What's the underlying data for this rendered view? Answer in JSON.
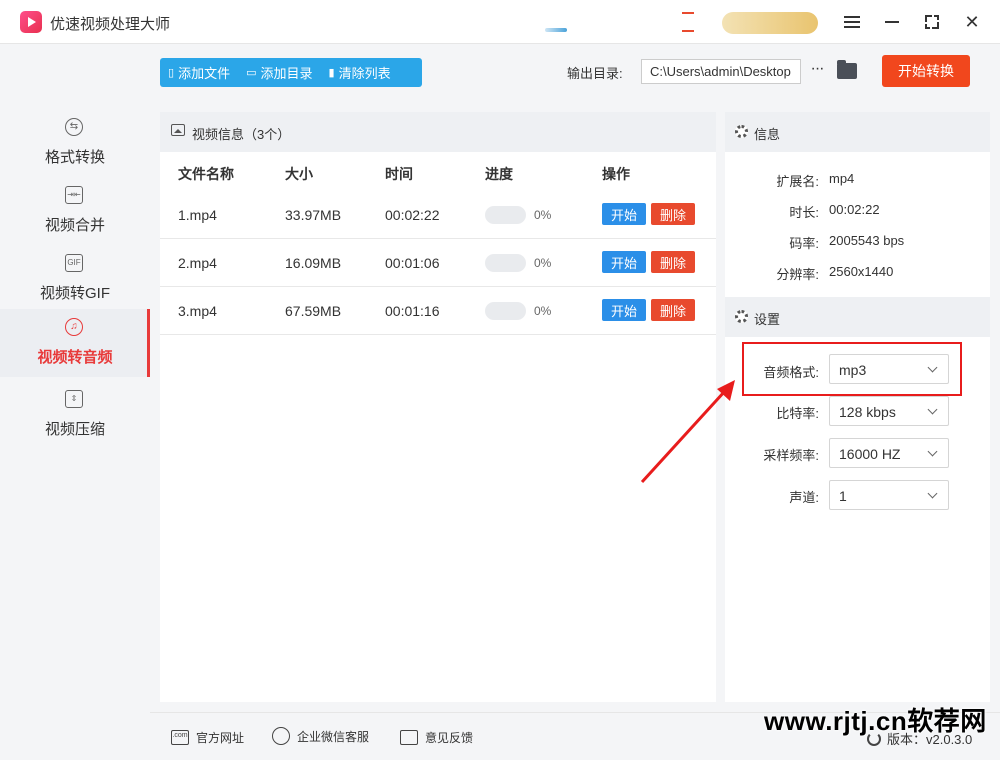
{
  "app": {
    "title": "优速视频处理大师"
  },
  "sidebar": {
    "items": [
      {
        "label": "格式转换",
        "icon": "swap-icon",
        "active": false
      },
      {
        "label": "视频合并",
        "icon": "merge-icon",
        "active": false
      },
      {
        "label": "视频转GIF",
        "icon": "gif-icon",
        "gif_text": "GIF",
        "active": false
      },
      {
        "label": "视频转音频",
        "icon": "audio-icon",
        "active": true
      },
      {
        "label": "视频压缩",
        "icon": "compress-icon",
        "active": false
      }
    ]
  },
  "toolbar": {
    "add_file": "添加文件",
    "add_folder": "添加目录",
    "clear_list": "清除列表",
    "output_label": "输出目录:",
    "output_path": "C:\\Users\\admin\\Desktop",
    "more": "···",
    "start_convert": "开始转换"
  },
  "file_panel": {
    "title": "视频信息（3个）",
    "columns": [
      "文件名称",
      "大小",
      "时间",
      "进度",
      "操作"
    ],
    "rows": [
      {
        "name": "1.mp4",
        "size": "33.97MB",
        "duration": "00:02:22",
        "progress": 0,
        "progress_text": "0%"
      },
      {
        "name": "2.mp4",
        "size": "16.09MB",
        "duration": "00:01:06",
        "progress": 0,
        "progress_text": "0%"
      },
      {
        "name": "3.mp4",
        "size": "67.59MB",
        "duration": "00:01:16",
        "progress": 0,
        "progress_text": "0%"
      }
    ],
    "start_label": "开始",
    "delete_label": "删除"
  },
  "info": {
    "title": "信息",
    "fields": [
      {
        "label": "扩展名:",
        "value": "mp4"
      },
      {
        "label": "时长:",
        "value": "00:02:22"
      },
      {
        "label": "码率:",
        "value": "2005543 bps"
      },
      {
        "label": "分辨率:",
        "value": "2560x1440"
      }
    ]
  },
  "settings": {
    "title": "设置",
    "fields": [
      {
        "label": "音频格式:",
        "value": "mp3"
      },
      {
        "label": "比特率:",
        "value": "128 kbps"
      },
      {
        "label": "采样频率:",
        "value": "16000 HZ"
      },
      {
        "label": "声道:",
        "value": "1"
      }
    ]
  },
  "footer": {
    "website": "官方网址",
    "website_icon_text": ".com",
    "wechat": "企业微信客服",
    "feedback": "意见反馈",
    "version": "版本：v2.0.3.0"
  },
  "watermark": "www.rjtj.cn软荐网",
  "colors": {
    "accent_blue": "#2ba6e8",
    "start_orange": "#f1471d",
    "delete_red": "#e84a2e",
    "active_red": "#e83a3a",
    "annotation_red": "#e81c1c"
  }
}
